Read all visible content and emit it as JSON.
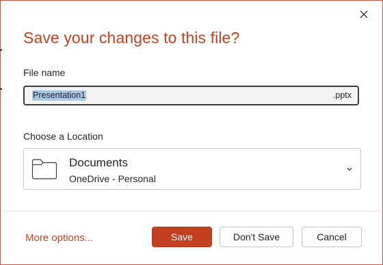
{
  "dialog": {
    "title": "Save your changes to this file?",
    "accent_color": "#c4431f",
    "close_icon": "close-icon"
  },
  "file_name": {
    "label": "File name",
    "value": "Presentation1",
    "extension": ".pptx",
    "selected": true
  },
  "location": {
    "label": "Choose a Location",
    "name": "Documents",
    "subtitle": "OneDrive - Personal",
    "icon": "folder-icon",
    "dropdown_icon": "chevron-down-icon"
  },
  "footer": {
    "more_options": "More options...",
    "save_label": "Save",
    "dont_save_label": "Don't Save",
    "cancel_label": "Cancel"
  }
}
